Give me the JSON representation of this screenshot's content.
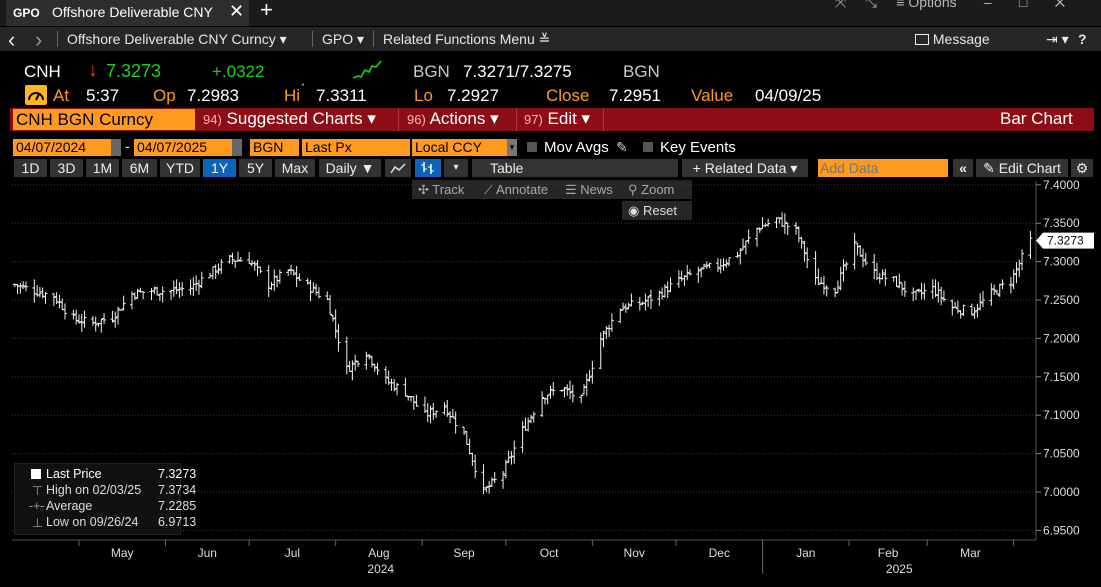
{
  "window": {
    "tab_logo": "GPO",
    "tab_title": "Offshore Deliverable CNY",
    "close_glyph": "✕",
    "new_tab_glyph": "+",
    "options": "≡ Options"
  },
  "nav": {
    "back": "‹",
    "forward": "›",
    "security": "Offshore Deliverable CNY Curncy ▾",
    "function": "GPO ▾",
    "related": "Related Functions Menu ≚",
    "message": "Message",
    "help": "?"
  },
  "quote": {
    "ticker": "CNH",
    "arrow": "↓",
    "last": "7.3273",
    "change": "+.0322",
    "bid_label": "BGN",
    "bid_ask": "7.3271/7.3275",
    "ask_label": "BGN",
    "at_label": "At",
    "at_time": "5:37",
    "open_label": "Op",
    "open": "7.2983",
    "high_label": "Hi",
    "high": "7.3311",
    "low_label": "Lo",
    "low": "7.2927",
    "close_label": "Close",
    "close": "7.2951",
    "value_label": "Value",
    "value_date": "04/09/25"
  },
  "function_bar": {
    "security": "CNH BGN Curncy",
    "suggested_num": "94)",
    "suggested": "Suggested Charts ▾",
    "actions_num": "96)",
    "actions": "Actions ▾",
    "edit_num": "97)",
    "edit": "Edit ▾",
    "chart_type": "Bar Chart"
  },
  "toolbar": {
    "start_date": "04/07/2024",
    "end_date": "04/07/2025",
    "source": "BGN",
    "field": "Last Px",
    "currency": "Local CCY",
    "mov_avgs": "Mov Avgs",
    "key_events": "Key Events",
    "ranges": [
      "1D",
      "3D",
      "1M",
      "6M",
      "YTD",
      "1Y",
      "5Y",
      "Max"
    ],
    "active_range": "1Y",
    "periodicity": "Daily ▼",
    "table": "Table",
    "related_data": "+ Related Data ▾",
    "add_data_placeholder": "Add Data",
    "edit_chart": "Edit Chart",
    "track": "Track",
    "annotate": "Annotate",
    "news": "News",
    "zoom": "Zoom",
    "reset": "Reset"
  },
  "colors": {
    "orange": "#ff9a1f",
    "red_bar": "#8c0d16",
    "active_blue": "#0d63b7",
    "green": "#19d219",
    "down_red": "#ff3b3b"
  },
  "chart_data": {
    "type": "bar",
    "y_ticks": [
      "7.4000",
      "7.3500",
      "7.3000",
      "7.2500",
      "7.2000",
      "7.1500",
      "7.1000",
      "7.0500",
      "7.0000",
      "6.9500"
    ],
    "ylim": [
      6.9375,
      7.405
    ],
    "x_months": [
      "May",
      "Jun",
      "Jul",
      "Aug",
      "Sep",
      "Oct",
      "Nov",
      "Dec",
      "Jan",
      "Feb",
      "Mar"
    ],
    "x_years": [
      "2024",
      "2025"
    ],
    "last_price_tag": "7.3273",
    "series_close_points": [
      [
        "2024-04-08",
        7.27
      ],
      [
        "2024-04-15",
        7.262
      ],
      [
        "2024-04-22",
        7.255
      ],
      [
        "2024-04-29",
        7.225
      ],
      [
        "2024-05-06",
        7.22
      ],
      [
        "2024-05-13",
        7.228
      ],
      [
        "2024-05-20",
        7.258
      ],
      [
        "2024-05-27",
        7.262
      ],
      [
        "2024-06-03",
        7.262
      ],
      [
        "2024-06-10",
        7.266
      ],
      [
        "2024-06-17",
        7.285
      ],
      [
        "2024-06-24",
        7.303
      ],
      [
        "2024-07-01",
        7.302
      ],
      [
        "2024-07-08",
        7.27
      ],
      [
        "2024-07-15",
        7.288
      ],
      [
        "2024-07-22",
        7.268
      ],
      [
        "2024-07-29",
        7.25
      ],
      [
        "2024-08-05",
        7.16
      ],
      [
        "2024-08-12",
        7.182
      ],
      [
        "2024-08-19",
        7.145
      ],
      [
        "2024-08-26",
        7.13
      ],
      [
        "2024-09-02",
        7.1
      ],
      [
        "2024-09-09",
        7.112
      ],
      [
        "2024-09-16",
        7.075
      ],
      [
        "2024-09-23",
        7.0
      ],
      [
        "2024-09-30",
        7.025
      ],
      [
        "2024-10-07",
        7.08
      ],
      [
        "2024-10-14",
        7.125
      ],
      [
        "2024-10-21",
        7.135
      ],
      [
        "2024-10-28",
        7.12
      ],
      [
        "2024-11-04",
        7.2
      ],
      [
        "2024-11-11",
        7.24
      ],
      [
        "2024-11-18",
        7.245
      ],
      [
        "2024-11-25",
        7.258
      ],
      [
        "2024-12-02",
        7.275
      ],
      [
        "2024-12-09",
        7.288
      ],
      [
        "2024-12-16",
        7.295
      ],
      [
        "2024-12-23",
        7.31
      ],
      [
        "2024-12-30",
        7.343
      ],
      [
        "2025-01-06",
        7.355
      ],
      [
        "2025-01-13",
        7.34
      ],
      [
        "2025-01-20",
        7.275
      ],
      [
        "2025-01-27",
        7.265
      ],
      [
        "2025-02-03",
        7.32
      ],
      [
        "2025-02-10",
        7.285
      ],
      [
        "2025-02-17",
        7.275
      ],
      [
        "2025-02-24",
        7.255
      ],
      [
        "2025-03-03",
        7.265
      ],
      [
        "2025-03-10",
        7.24
      ],
      [
        "2025-03-17",
        7.235
      ],
      [
        "2025-03-24",
        7.258
      ],
      [
        "2025-03-31",
        7.275
      ],
      [
        "2025-04-07",
        7.327
      ]
    ],
    "legend": [
      {
        "label": "Last Price",
        "value": "7.3273"
      },
      {
        "label": "High on 02/03/25",
        "value": "7.3734"
      },
      {
        "label": "Average",
        "value": "7.2285"
      },
      {
        "label": "Low on 09/26/24",
        "value": "6.9713"
      }
    ]
  }
}
